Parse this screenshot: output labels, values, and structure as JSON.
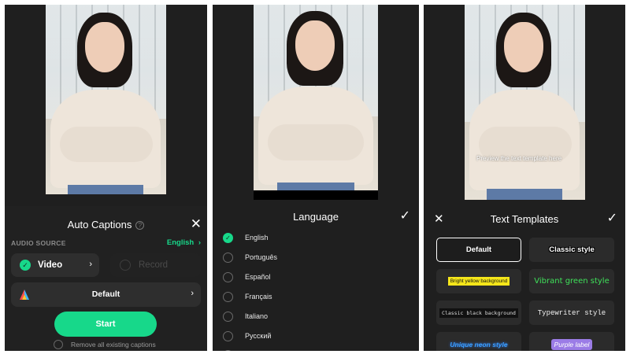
{
  "panel1": {
    "title": "Auto Captions",
    "help_glyph": "?",
    "close_glyph": "✕",
    "audio_source_label": "AUDIO SOURCE",
    "language_link": "English",
    "link_chevron": "›",
    "video_option": "Video",
    "record_option": "Record",
    "chevron": "›",
    "style_label": "Default",
    "start_label": "Start",
    "remove_label": "Remove all existing captions",
    "accent": "#17d88a"
  },
  "panel2": {
    "title": "Language",
    "confirm_glyph": "✓",
    "selected_glyph": "✓",
    "languages": [
      "English",
      "Português",
      "Español",
      "Français",
      "Italiano",
      "Русский"
    ]
  },
  "panel3": {
    "title": "Text Templates",
    "close_glyph": "✕",
    "confirm_glyph": "✓",
    "preview_text": "Preview the text template here",
    "templates": [
      "Default",
      "Classic style",
      "Bright yellow background",
      "Vibrant green style",
      "Classic black background",
      "Typewriter style",
      "Unique neon style",
      "Purple label"
    ]
  },
  "icons": {
    "close": "close-icon",
    "check": "check-icon",
    "chevron": "chevron-right-icon",
    "help": "help-icon",
    "logo": "app-logo-icon"
  }
}
